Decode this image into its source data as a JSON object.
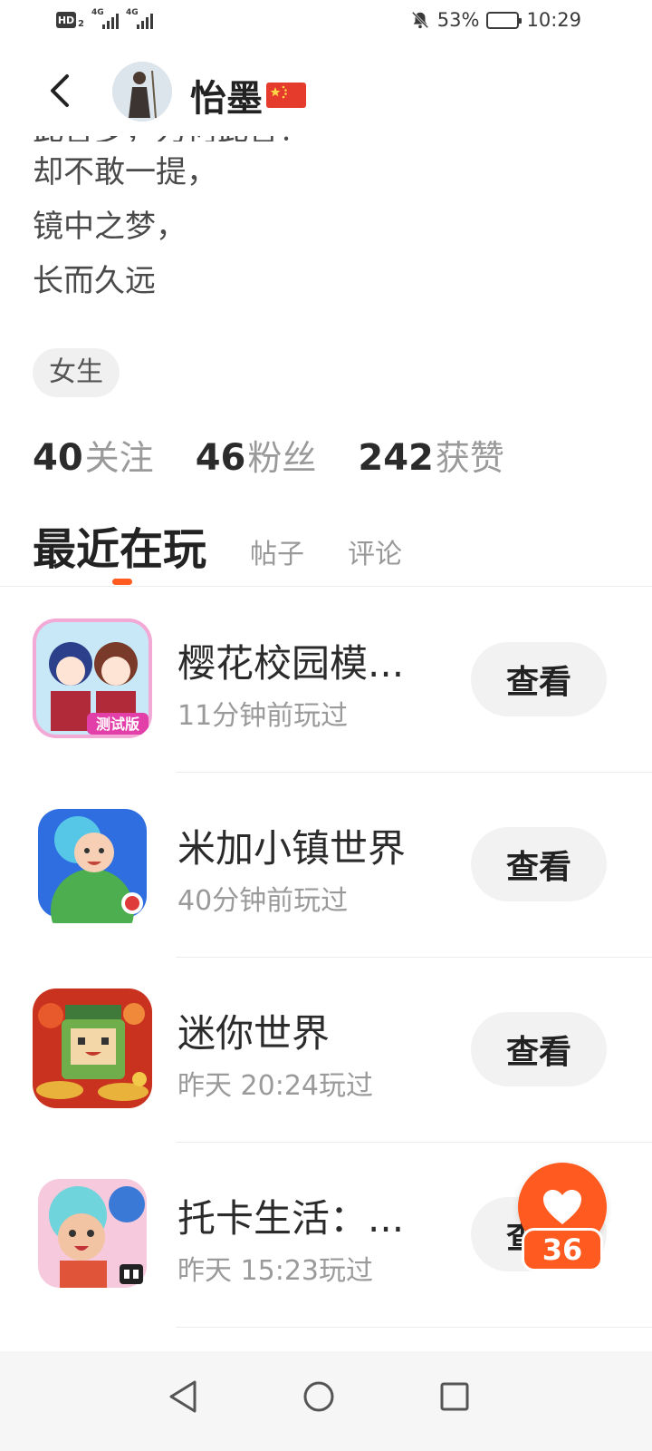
{
  "status_bar": {
    "hd_label": "HD",
    "hd_sub": "2",
    "net1": "4G",
    "net2": "4G",
    "battery_pct": "53%",
    "battery_level": 0.53,
    "time": "10:29"
  },
  "header": {
    "name": "怡墨"
  },
  "bio": {
    "cut_line": "此言多，为何此言？",
    "lines": [
      "却不敢一提，",
      "镜中之梦，",
      "长而久远"
    ]
  },
  "tag": "女生",
  "stats": [
    {
      "num": "40",
      "label": "关注"
    },
    {
      "num": "46",
      "label": "粉丝"
    },
    {
      "num": "242",
      "label": "获赞"
    }
  ],
  "tabs": [
    "最近在玩",
    "帖子",
    "评论"
  ],
  "games": [
    {
      "name": "樱花校园模...",
      "time": "11分钟前玩过",
      "button": "查看",
      "icon_badge": "测试版"
    },
    {
      "name": "米加小镇世界",
      "time": "40分钟前玩过",
      "button": "查看"
    },
    {
      "name": "迷你世界",
      "time": "昨天 20:24玩过",
      "button": "查看"
    },
    {
      "name": "托卡生活：...",
      "time": "昨天 15:23玩过",
      "button": "查看"
    }
  ],
  "like": {
    "count": "36"
  },
  "colors": {
    "accent": "#ff5a1f",
    "muted": "#9a9a9a"
  }
}
